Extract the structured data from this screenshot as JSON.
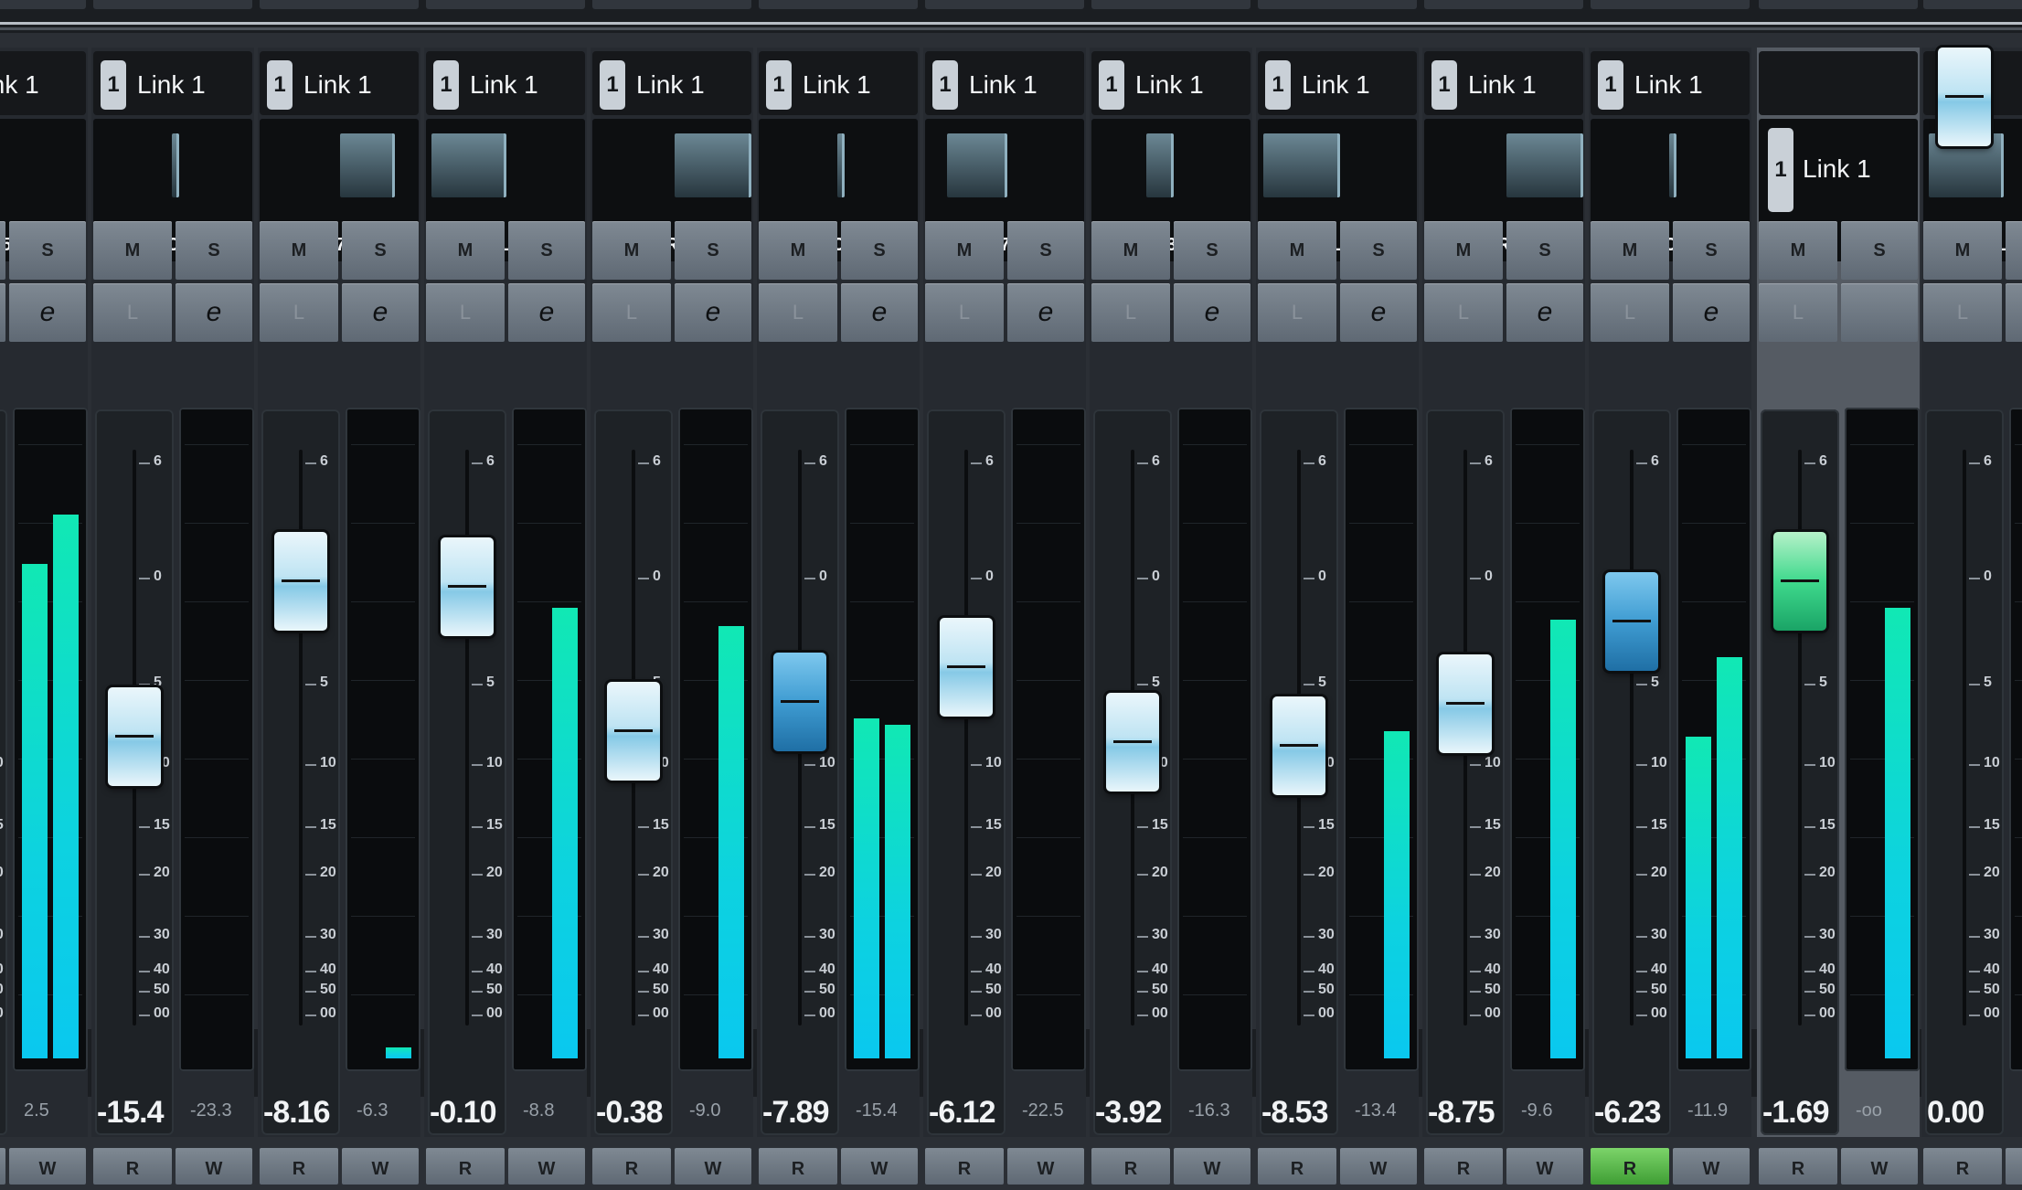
{
  "colors": {
    "meter": "#0dd2e0",
    "read_active": "#5fbf4c",
    "selected_strip": "#555b63"
  },
  "link_badge": "1",
  "link_label": "Link 1",
  "buttons": {
    "mute": "M",
    "solo": "S",
    "listen": "L",
    "edit": "e",
    "read": "R",
    "write": "W"
  },
  "scale": [
    "6",
    "0",
    "5",
    "10",
    "15",
    "20",
    "30",
    "40",
    "50",
    "00"
  ],
  "channels": [
    {
      "pan": "250",
      "fader_value": "",
      "peak": "2.5"
    },
    {
      "pan": "C",
      "fader_value": "-15.4",
      "peak": "-23.3"
    },
    {
      "pan": "R70",
      "fader_value": "-8.16",
      "peak": "-6.3"
    },
    {
      "pan": "L",
      "fader_value": "-0.10",
      "peak": "-8.8"
    },
    {
      "pan": "R",
      "fader_value": "-0.38",
      "peak": "-9.0"
    },
    {
      "pan": "C",
      "fader_value": "-7.89",
      "peak": "-15.4"
    },
    {
      "pan": "L76",
      "fader_value": "-6.12",
      "peak": "-22.5"
    },
    {
      "pan": "L31",
      "fader_value": "-3.92",
      "peak": "-16.3"
    },
    {
      "pan": "L",
      "fader_value": "-8.53",
      "peak": "-13.4"
    },
    {
      "pan": "R",
      "fader_value": "-8.75",
      "peak": "-9.6"
    },
    {
      "pan": "C",
      "fader_value": "-6.23",
      "peak": "-11.9"
    },
    {
      "pan": "",
      "fader_value": "-1.69",
      "peak": "-oo"
    },
    {
      "pan": "L",
      "fader_value": "0.00",
      "peak": ""
    }
  ],
  "meter_levels": [
    [
      0.8,
      0.88
    ],
    [
      0,
      0
    ],
    [
      0,
      0.018
    ],
    [
      0,
      0.73
    ],
    [
      0,
      0.7
    ],
    [
      0.55,
      0.54
    ],
    [
      0,
      0
    ],
    [
      0,
      0
    ],
    [
      0,
      0.53
    ],
    [
      0,
      0.71
    ],
    [
      0.52,
      0.65
    ],
    [
      0,
      0.73
    ],
    [
      0,
      0
    ]
  ]
}
